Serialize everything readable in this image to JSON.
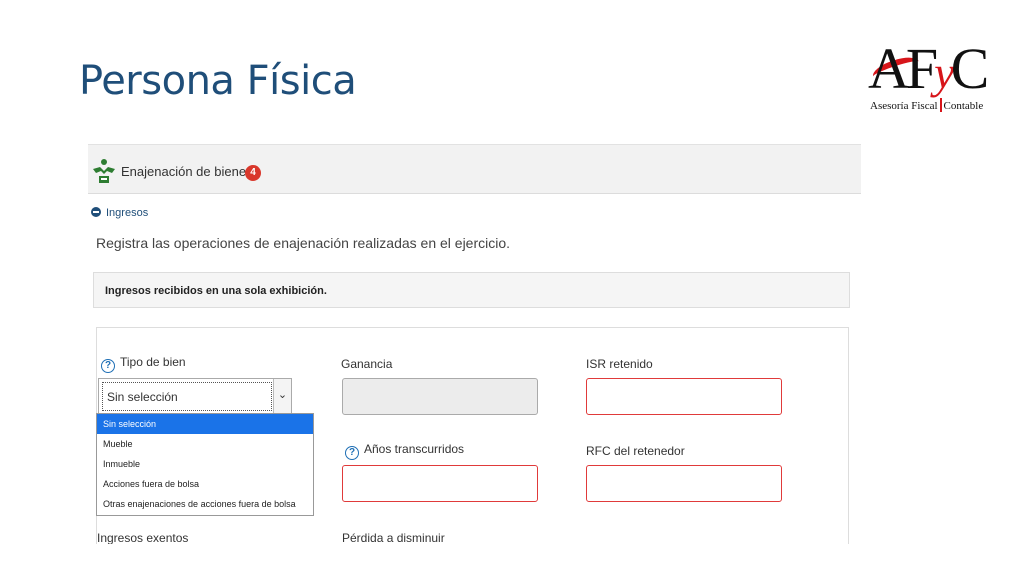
{
  "slide": {
    "title": "Persona Física"
  },
  "logo": {
    "letters_a": "AF",
    "letter_y": "y",
    "letter_c": "C",
    "sub_left": "Asesoría Fiscal",
    "sub_right": "Contable"
  },
  "section": {
    "title": "Enajenación de bienes",
    "badge": "4",
    "icon": "handshake-icon"
  },
  "toggle": {
    "label": "Ingresos",
    "icon": "collapse-minus-icon"
  },
  "intro": "Registra las operaciones de enajenación realizadas en el ejercicio.",
  "panel": {
    "header": "Ingresos recibidos en una sola exhibición."
  },
  "fields": {
    "tipo_bien": {
      "label": "Tipo de bien",
      "value": "Sin selección"
    },
    "ganancia": {
      "label": "Ganancia",
      "value": ""
    },
    "isr": {
      "label": "ISR retenido",
      "value": ""
    },
    "anios": {
      "label": "Años transcurridos",
      "value": ""
    },
    "rfc": {
      "label": "RFC del retenedor",
      "value": ""
    },
    "exentos": {
      "label": "Ingresos exentos"
    },
    "perdida": {
      "label": "Pérdida a disminuir"
    }
  },
  "dropdown": {
    "options": [
      "Sin selección",
      "Mueble",
      "Inmueble",
      "Acciones fuera de bolsa",
      "Otras enajenaciones de acciones fuera de bolsa"
    ],
    "selected_index": 0
  },
  "colors": {
    "title": "#1f4e79",
    "badge": "#d9382c",
    "required_border": "#e03a3a",
    "selected_option": "#1a73e8",
    "logo_red": "#d7151a"
  }
}
